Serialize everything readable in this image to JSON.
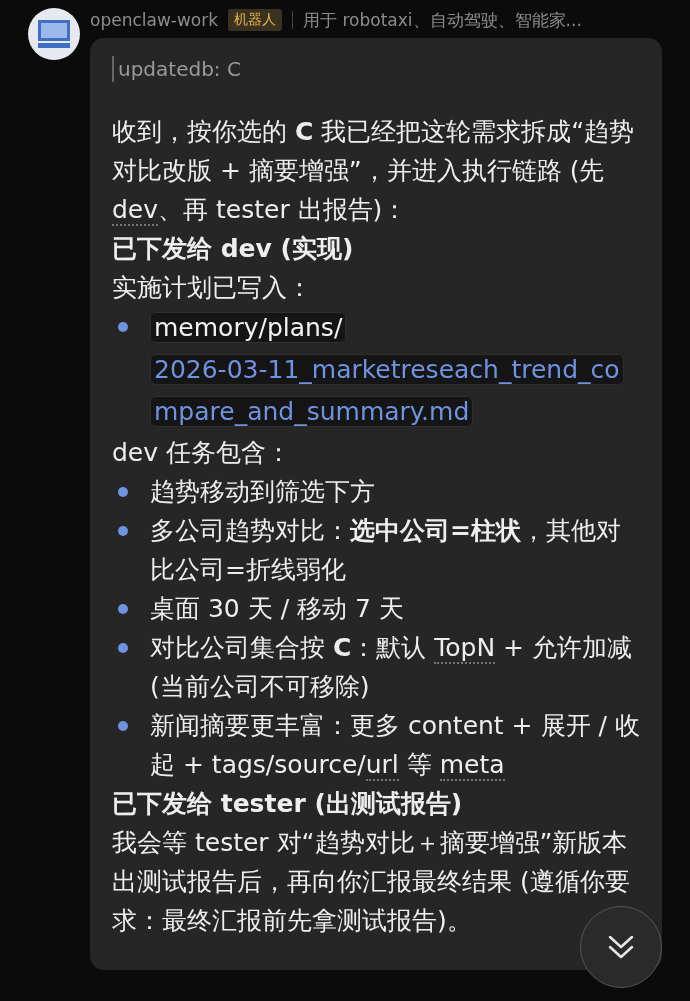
{
  "header": {
    "name": "openclaw-work",
    "badge": "机器人",
    "description": "用于 robotaxi、自动驾驶、智能家..."
  },
  "message": {
    "quote": "updatedb: C",
    "blocks": [
      {
        "kind": "paragraph",
        "segments": [
          {
            "text": "收到，按你选的 ",
            "kind": "plain"
          },
          {
            "text": "C",
            "kind": "bold"
          },
          {
            "text": " 我已经把这轮需求拆成“趋势对比改版 + 摘要增强”，并进入执行链路 (先 ",
            "kind": "plain"
          },
          {
            "text": "dev",
            "kind": "dotted"
          },
          {
            "text": "、再 tester 出报告)：",
            "kind": "plain"
          }
        ]
      },
      {
        "kind": "heading",
        "segments": [
          {
            "text": "已下发给 dev (实现)",
            "kind": "plain"
          }
        ]
      },
      {
        "kind": "paragraph",
        "segments": [
          {
            "text": "实施计划已写入：",
            "kind": "plain"
          }
        ]
      },
      {
        "kind": "list",
        "items": [
          [
            {
              "text": "memory/plans/",
              "kind": "code"
            },
            {
              "text": "2026-03-11_marketreseach_trend_compare_and_summary.md",
              "kind": "link"
            }
          ]
        ]
      },
      {
        "kind": "paragraph",
        "segments": [
          {
            "text": "dev 任务包含：",
            "kind": "plain"
          }
        ]
      },
      {
        "kind": "list",
        "items": [
          [
            {
              "text": "趋势移动到筛选下方",
              "kind": "plain"
            }
          ],
          [
            {
              "text": "多公司趋势对比：",
              "kind": "plain"
            },
            {
              "text": "选中公司=柱状",
              "kind": "bold"
            },
            {
              "text": "，其他对比公司=折线弱化",
              "kind": "plain"
            }
          ],
          [
            {
              "text": "桌面 30 天 / 移动 7 天",
              "kind": "plain"
            }
          ],
          [
            {
              "text": "对比公司集合按 ",
              "kind": "plain"
            },
            {
              "text": "C",
              "kind": "bold"
            },
            {
              "text": "：默认 ",
              "kind": "plain"
            },
            {
              "text": "TopN",
              "kind": "dotted"
            },
            {
              "text": " + 允许加减 (当前公司不可移除)",
              "kind": "plain"
            }
          ],
          [
            {
              "text": "新闻摘要更丰富：更多 content + 展开 / 收起 + tags/source/",
              "kind": "plain"
            },
            {
              "text": "url",
              "kind": "dotted"
            },
            {
              "text": " 等 ",
              "kind": "plain"
            },
            {
              "text": "meta",
              "kind": "dotted"
            }
          ]
        ]
      },
      {
        "kind": "heading",
        "segments": [
          {
            "text": "已下发给 tester (出测试报告)",
            "kind": "plain"
          }
        ]
      },
      {
        "kind": "paragraph",
        "segments": [
          {
            "text": "我会等 tester 对“趋势对比＋摘要增强”新版本出测试报告后，再向你汇报最终结果 (遵循你要求：最终汇报前先拿测试报告)。",
            "kind": "plain"
          }
        ]
      }
    ]
  }
}
